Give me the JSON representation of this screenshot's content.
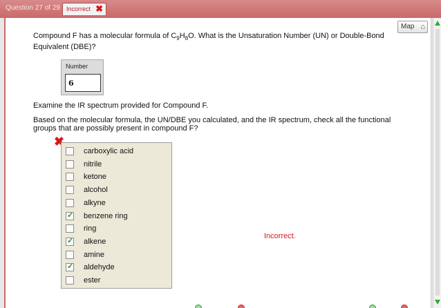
{
  "header": {
    "question_counter": "Question 27 of 29",
    "status_tab": "Incorrect"
  },
  "map_button": {
    "label": "Map"
  },
  "question": {
    "text_before": "Compound F has a molecular formula of C",
    "sub1": "9",
    "text_mid": "H",
    "sub2": "8",
    "text_after": "O. What is the Unsaturation Number (UN) or Double-Bond Equivalent (DBE)?"
  },
  "number_input": {
    "label": "Number",
    "value": "6"
  },
  "ir_prompt": "Examine the IR spectrum provided for Compound F.",
  "based_prompt": "Based on the molecular formula, the UN/DBE you calculated, and the IR spectrum, check all the functional groups that are possibly present in compound F?",
  "functional_groups": [
    {
      "label": "carboxylic acid",
      "checked": false
    },
    {
      "label": "nitrile",
      "checked": false
    },
    {
      "label": "ketone",
      "checked": false
    },
    {
      "label": "alcohol",
      "checked": false
    },
    {
      "label": "alkyne",
      "checked": false
    },
    {
      "label": "benzene ring",
      "checked": true
    },
    {
      "label": "ring",
      "checked": false
    },
    {
      "label": "alkene",
      "checked": true
    },
    {
      "label": "amine",
      "checked": false
    },
    {
      "label": "aldehyde",
      "checked": true
    },
    {
      "label": "ester",
      "checked": false
    }
  ],
  "result_text": "Incorrect.",
  "colors": {
    "incorrect": "#d11a1a",
    "check": "#2f8f2f",
    "tab_bg": "#c86a6a"
  },
  "icons": {
    "status": "close-x-icon",
    "map": "map-icon",
    "wrong": "wrong-x-icon"
  }
}
